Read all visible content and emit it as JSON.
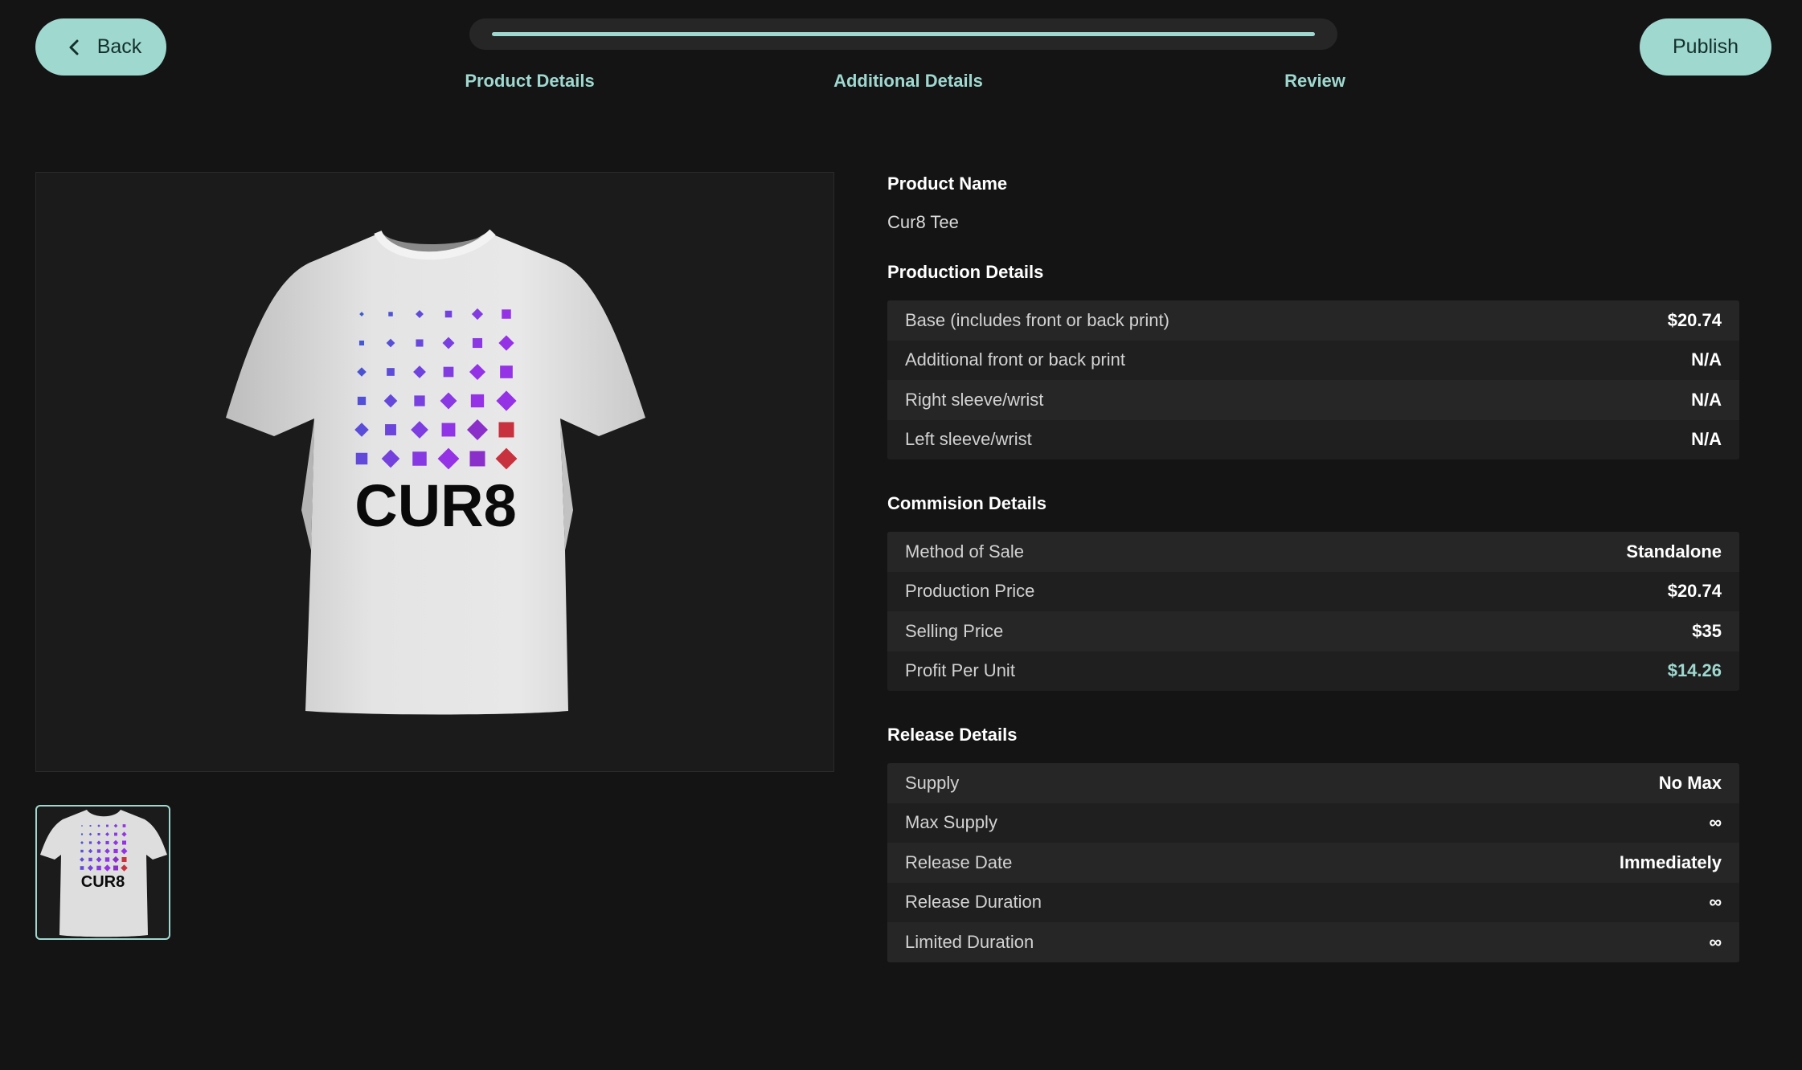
{
  "header": {
    "back_label": "Back",
    "publish_label": "Publish",
    "progress": 1.0,
    "steps": [
      {
        "label": "Product Details"
      },
      {
        "label": "Additional Details"
      },
      {
        "label": "Review"
      }
    ]
  },
  "colors": {
    "accent": "#9fd8cf",
    "background": "#141414",
    "row_light": "#262626",
    "row_dark": "#1f1f1f"
  },
  "preview": {
    "shirt_logo_text": "CUR8"
  },
  "product_name": {
    "title": "Product Name",
    "value": "Cur8 Tee"
  },
  "production": {
    "title": "Production Details",
    "rows": [
      {
        "label": "Base (includes front or back print)",
        "value": "$20.74"
      },
      {
        "label": "Additional front or back print",
        "value": "N/A"
      },
      {
        "label": "Right sleeve/wrist",
        "value": "N/A"
      },
      {
        "label": "Left sleeve/wrist",
        "value": "N/A"
      }
    ]
  },
  "commission": {
    "title": "Commision Details",
    "rows": [
      {
        "label": "Method of Sale",
        "value": "Standalone"
      },
      {
        "label": "Production Price",
        "value": "$20.74"
      },
      {
        "label": "Selling Price",
        "value": "$35"
      },
      {
        "label": "Profit Per Unit",
        "value": "$14.26"
      }
    ]
  },
  "release": {
    "title": "Release Details",
    "rows": [
      {
        "label": "Supply",
        "value": "No Max"
      },
      {
        "label": "Max Supply",
        "value": "∞"
      },
      {
        "label": "Release Date",
        "value": "Immediately"
      },
      {
        "label": "Release Duration",
        "value": "∞"
      },
      {
        "label": "Limited Duration",
        "value": "∞"
      }
    ]
  }
}
